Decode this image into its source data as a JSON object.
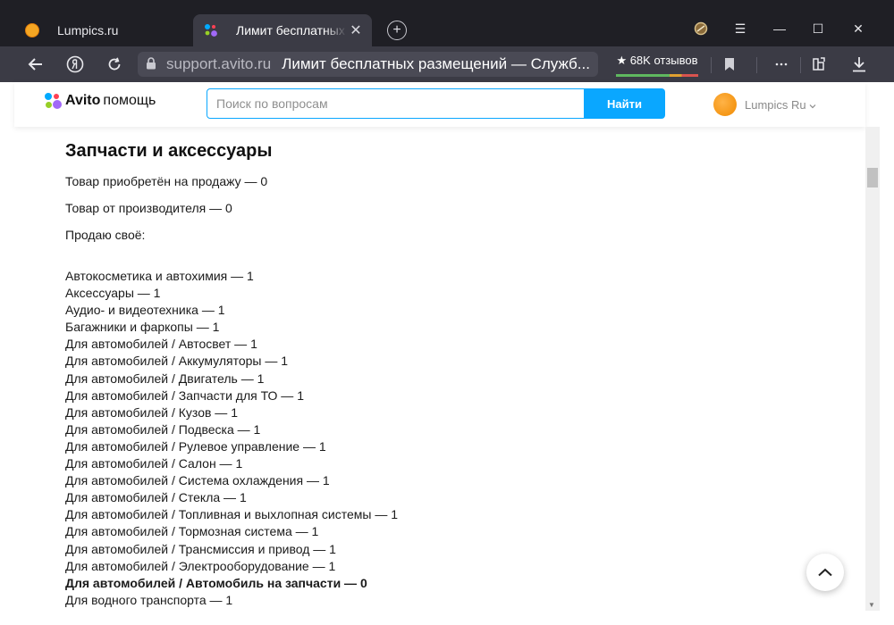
{
  "browser": {
    "tabs": [
      {
        "title": "Lumpics.ru"
      },
      {
        "title": "Лимит бесплатных разм",
        "close": "✕"
      }
    ],
    "new_tab": "+",
    "window_controls": {
      "menu": "☰",
      "minimize": "—",
      "maximize": "☐",
      "close": "✕"
    },
    "address": {
      "host": "support.avito.ru",
      "page_title": "Лимит бесплатных размещений — Служб..."
    },
    "reviews_badge": "★ 68K отзывов"
  },
  "site": {
    "logo_brand": "Avito",
    "logo_suffix": "помощь",
    "search_placeholder": "Поиск по вопросам",
    "search_button": "Найти",
    "user_name": "Lumpics Ru"
  },
  "content": {
    "heading": "Запчасти и аксессуары",
    "line1": "Товар приобретён на продажу — 0",
    "line2": "Товар от производителя — 0",
    "line3": "Продаю своё:",
    "items": [
      "Автокосметика и автохимия — 1",
      "Аксессуары — 1",
      "Аудио- и видеотехника — 1",
      "Багажники и фаркопы — 1",
      "Для автомобилей / Автосвет — 1",
      "Для автомобилей / Аккумуляторы — 1",
      "Для автомобилей / Двигатель — 1",
      "Для автомобилей / Запчасти для ТО — 1",
      "Для автомобилей / Кузов — 1",
      "Для автомобилей / Подвеска — 1",
      "Для автомобилей / Рулевое управление — 1",
      "Для автомобилей / Салон — 1",
      "Для автомобилей / Система охлаждения — 1",
      "Для автомобилей / Стекла — 1",
      "Для автомобилей / Топливная и выхлопная системы — 1",
      "Для автомобилей / Тормозная система — 1",
      "Для автомобилей / Трансмиссия и привод — 1",
      "Для автомобилей / Электрооборудование — 1",
      "Для автомобилей / Автомобиль на запчасти — 0",
      "Для водного транспорта — 1"
    ],
    "bold_item_index": 18
  },
  "colors": {
    "tab_bar": "#1f1f25",
    "toolbar": "#3b3b45",
    "accent": "#0aa7ff"
  }
}
